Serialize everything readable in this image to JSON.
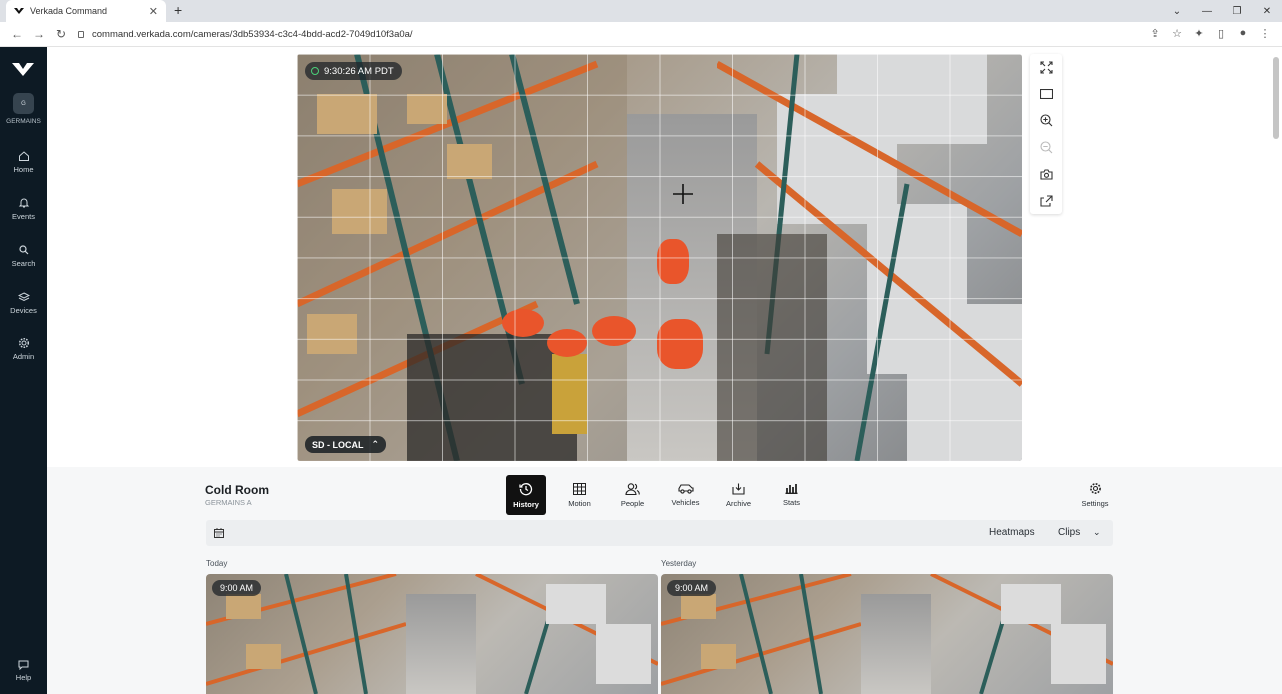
{
  "browser": {
    "tab_title": "Verkada Command",
    "tab_close": "✕",
    "new_tab": "+",
    "url": "command.verkada.com/cameras/3db53934-c3c4-4bdd-acd2-7049d10f3a0a/"
  },
  "sidebar": {
    "org_initial": "G",
    "org_label": "GERMAINS",
    "items": [
      {
        "label": "Home",
        "icon": "home-icon"
      },
      {
        "label": "Events",
        "icon": "bell-icon"
      },
      {
        "label": "Search",
        "icon": "search-icon"
      },
      {
        "label": "Devices",
        "icon": "layers-icon"
      },
      {
        "label": "Admin",
        "icon": "gear-icon"
      }
    ],
    "help_label": "Help"
  },
  "video": {
    "timestamp": "9:30:26 AM PDT",
    "quality_label": "SD - LOCAL",
    "live_dot_color": "#4ad07a"
  },
  "camera": {
    "name": "Cold Room",
    "site": "GERMAINS A"
  },
  "view_tabs": [
    {
      "label": "History",
      "icon": "history-icon",
      "active": true
    },
    {
      "label": "Motion",
      "icon": "grid-icon"
    },
    {
      "label": "People",
      "icon": "people-icon"
    },
    {
      "label": "Vehicles",
      "icon": "car-icon"
    },
    {
      "label": "Archive",
      "icon": "archive-icon"
    },
    {
      "label": "Stats",
      "icon": "bar-chart-icon"
    }
  ],
  "settings_label": "Settings",
  "toolbar": {
    "heatmaps_label": "Heatmaps",
    "clips_label": "Clips"
  },
  "history": {
    "today_label": "Today",
    "yesterday_label": "Yesterday",
    "today_time": "9:00 AM",
    "yesterday_time": "9:00 AM"
  }
}
